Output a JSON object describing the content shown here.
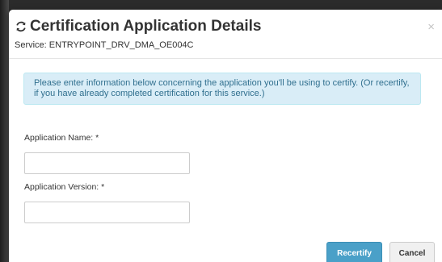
{
  "modal": {
    "title": "Certification Application Details",
    "subtitle": "Service: ENTRYPOINT_DRV_DMA_OE004C",
    "close_label": "×"
  },
  "info": {
    "message": "Please enter information below concerning the application you'll be using to certify. (Or recertify, if you have already completed certification for this service.)"
  },
  "form": {
    "application_name": {
      "label": "Application Name: *",
      "value": "",
      "placeholder": ""
    },
    "application_version": {
      "label": "Application Version: *",
      "value": "",
      "placeholder": ""
    }
  },
  "buttons": {
    "recertify_label": "Recertify",
    "cancel_label": "Cancel"
  },
  "colors": {
    "info_background": "#d9edf7",
    "info_text": "#31708f",
    "primary_button": "#4aa0c8"
  },
  "icons": {
    "title_icon": "refresh-icon",
    "close_icon": "close-icon"
  }
}
